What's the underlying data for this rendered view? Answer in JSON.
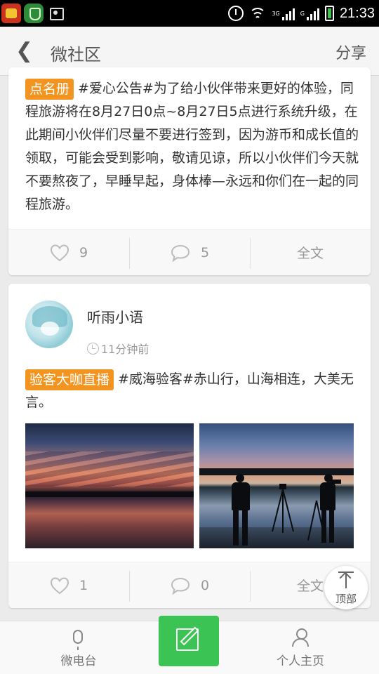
{
  "status_bar": {
    "time": "21:33",
    "signal1_label": "3G",
    "signal2_label": "G",
    "icons": [
      "app-icon",
      "shield-app-icon",
      "screenshot-icon",
      "alarm-icon",
      "wifi-icon",
      "signal-icon",
      "battery-icon"
    ]
  },
  "header": {
    "back_glyph": "❮",
    "title": "微社区",
    "share_label": "分享"
  },
  "posts": [
    {
      "tag": "点名册",
      "text": "#爱心公告#为了给小伙伴带来更好的体验，同程旅游将在8月27日0点~8月27日5点进行系统升级，在此期间小伙伴们尽量不要进行签到，因为游币和成长值的领取，可能会受到影响，敬请见谅，所以小伙伴们今天就不要熬夜了，早睡早起，身体棒—永远和你们在一起的同程旅游。",
      "likes": "9",
      "comments": "5",
      "full_text_label": "全文"
    },
    {
      "author": "听雨小语",
      "time": "11分钟前",
      "tag": "验客大咖直播",
      "text": "#威海验客#赤山行，山海相连，大美无言。",
      "likes": "1",
      "comments": "0",
      "full_text_label": "全文"
    }
  ],
  "to_top_label": "顶部",
  "bottom_nav": {
    "left_label": "微电台",
    "right_label": "个人主页"
  },
  "colors": {
    "tag_bg": "#f39420",
    "compose_bg": "#3bc454",
    "page_bg": "#ebebeb"
  }
}
